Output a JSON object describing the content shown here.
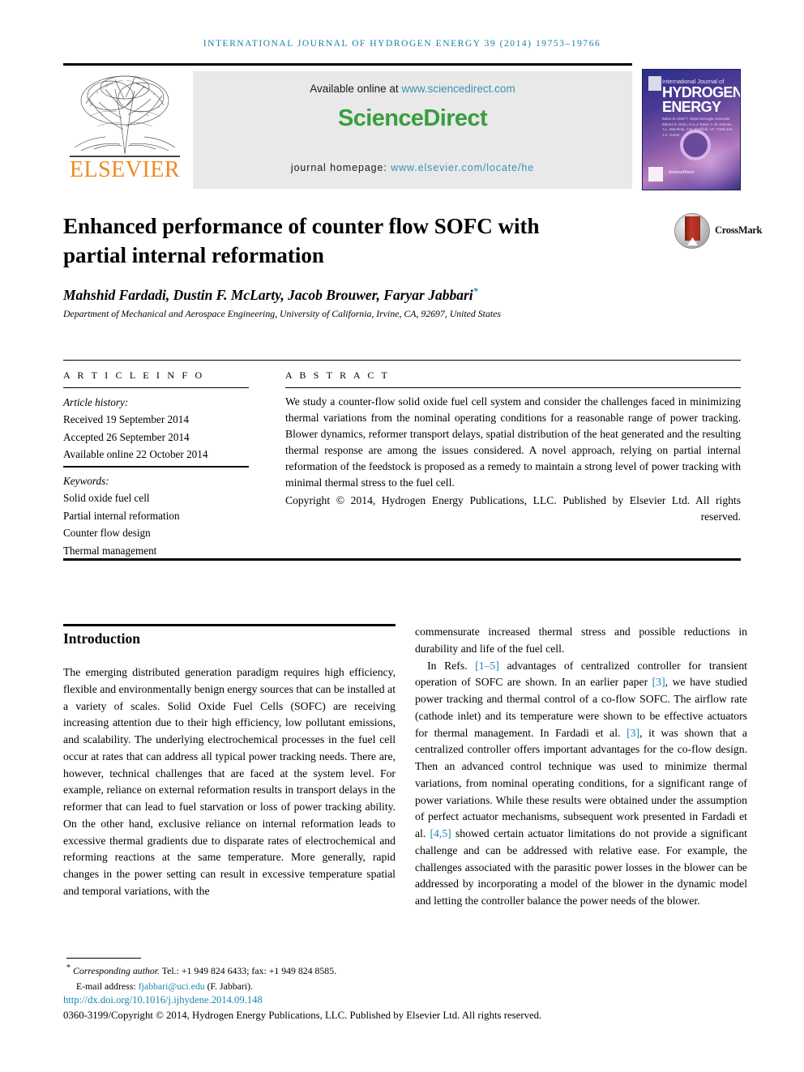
{
  "running_head": "International Journal of Hydrogen Energy 39 (2014) 19753–19766",
  "masthead": {
    "publisher_logo_text": "ELSEVIER",
    "available_prefix": "Available online at ",
    "available_link": "www.sciencedirect.com",
    "sciencedirect_logo": "ScienceDirect",
    "homepage_prefix": "journal homepage: ",
    "homepage_link": "www.elsevier.com/locate/he"
  },
  "cover": {
    "line_small": "International Journal of",
    "line_big_1": "HYDROGEN",
    "line_big_2": "ENERGY",
    "editor_block": "Editor-in-Chief  T. Nejat Veziroglu\nAssociate Editors  S. Dunn, D.A.J. Rand, A. M. Kannan,\nA.L. Marchetti, J.W. Sheffield,\nI.E. Török and J.A. Turner",
    "footer_mark": "ScienceDirect"
  },
  "title": "Enhanced performance of counter flow SOFC with partial internal reformation",
  "crossmark_label": "CrossMark",
  "authors": "Mahshid Fardadi, Dustin F. McLarty, Jacob Brouwer, Faryar Jabbari",
  "author_star": "*",
  "affiliation": "Department of Mechanical and Aerospace Engineering, University of California, Irvine, CA, 92697, United States",
  "article_info": {
    "heading": "A R T I C L E  I N F O",
    "history_label": "Article history:",
    "history": [
      "Received 19 September 2014",
      "Accepted 26 September 2014",
      "Available online 22 October 2014"
    ],
    "keywords_label": "Keywords:",
    "keywords": [
      "Solid oxide fuel cell",
      "Partial internal reformation",
      "Counter flow design",
      "Thermal management"
    ]
  },
  "abstract": {
    "heading": "A B S T R A C T",
    "paragraph": "We study a counter-flow solid oxide fuel cell system and consider the challenges faced in minimizing thermal variations from the nominal operating conditions for a reasonable range of power tracking. Blower dynamics, reformer transport delays, spatial distribution of the heat generated and the resulting thermal response are among the issues considered. A novel approach, relying on partial internal reformation of the feedstock is proposed as a remedy to maintain a strong level of power tracking with minimal thermal stress to the fuel cell.",
    "copyright": "Copyright © 2014, Hydrogen Energy Publications, LLC. Published by Elsevier Ltd. All rights reserved."
  },
  "body": {
    "section_title": "Introduction",
    "left_paragraph": "The emerging distributed generation paradigm requires high efficiency, flexible and environmentally benign energy sources that can be installed at a variety of scales. Solid Oxide Fuel Cells (SOFC) are receiving increasing attention due to their high efficiency, low pollutant emissions, and scalability. The underlying electrochemical processes in the fuel cell occur at rates that can address all typical power tracking needs. There are, however, technical challenges that are faced at the system level. For example, reliance on external reformation results in transport delays in the reformer that can lead to fuel starvation or loss of power tracking ability. On the other hand, exclusive reliance on internal reformation leads to excessive thermal gradients due to disparate rates of electrochemical and reforming reactions at the same temperature. More generally, rapid changes in the power setting can result in excessive temperature spatial and temporal variations, with the",
    "right_paragraph_1": "commensurate increased thermal stress and possible reductions in durability and life of the fuel cell.",
    "right_paragraph_2_a": "In Refs. ",
    "right_ref_1": "[1–5]",
    "right_paragraph_2_b": " advantages of centralized controller for transient operation of SOFC are shown. In an earlier paper ",
    "right_ref_2": "[3]",
    "right_paragraph_2_c": ", we have studied power tracking and thermal control of a co-flow SOFC. The airflow rate (cathode inlet) and its temperature were shown to be effective actuators for thermal management. In Fardadi et al. ",
    "right_ref_3": "[3]",
    "right_paragraph_2_d": ", it was shown that a centralized controller offers important advantages for the co-flow design. Then an advanced control technique was used to minimize thermal variations, from nominal operating conditions, for a significant range of power variations. While these results were obtained under the assumption of perfect actuator mechanisms, subsequent work presented in Fardadi et al. ",
    "right_ref_4": "[4,5]",
    "right_paragraph_2_e": " showed certain actuator limitations do not provide a significant challenge and can be addressed with relative ease. For example, the challenges associated with the parasitic power losses in the blower can be addressed by incorporating a model of the blower in the dynamic model and letting the controller balance the power needs of the blower."
  },
  "footer": {
    "corresponding_star": "*",
    "corresponding_label": "Corresponding author.",
    "corresponding_contact": " Tel.: +1 949 824 6433; fax: +1 949 824 8585.",
    "email_label": "E-mail address: ",
    "email_link": "fjabbari@uci.edu",
    "email_suffix": " (F. Jabbari).",
    "doi": "http://dx.doi.org/10.1016/j.ijhydene.2014.09.148",
    "issn_copyright": "0360-3199/Copyright © 2014, Hydrogen Energy Publications, LLC. Published by Elsevier Ltd. All rights reserved."
  },
  "colors": {
    "link": "#1b86b0",
    "sciencedirect_green": "#389e3e",
    "elsevier_orange": "#ef8b22",
    "running_head": "#1b7fa8"
  }
}
